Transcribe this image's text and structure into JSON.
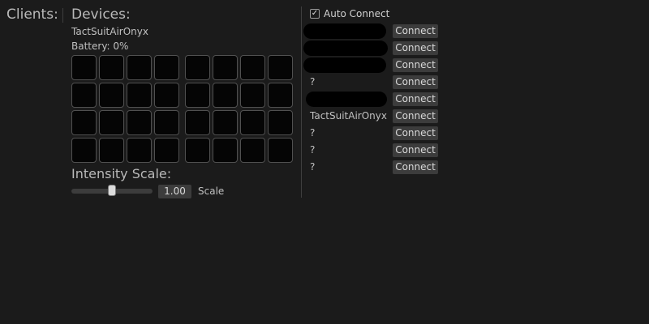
{
  "clients": {
    "title": "Clients:"
  },
  "devices": {
    "title": "Devices:",
    "device_name": "TactSuitAirOnyx",
    "battery": "Battery: 0%",
    "left_grid_cells": 16,
    "right_grid_cells": 16
  },
  "intensity": {
    "title": "Intensity Scale:",
    "value": "1.00",
    "label": "Scale",
    "slider_fraction": 0.5
  },
  "auto_connect": {
    "label": "Auto Connect",
    "checked": true
  },
  "device_list": [
    {
      "text": "",
      "redacted": true
    },
    {
      "text": "",
      "redacted": true
    },
    {
      "text": "",
      "redacted": true
    },
    {
      "text": "?",
      "redacted": false
    },
    {
      "text": "",
      "redacted": true
    },
    {
      "text": "TactSuitAirOnyx",
      "redacted": false
    },
    {
      "text": "?",
      "redacted": false
    },
    {
      "text": "?",
      "redacted": false
    },
    {
      "text": "?",
      "redacted": false
    }
  ],
  "connect_label": "Connect"
}
